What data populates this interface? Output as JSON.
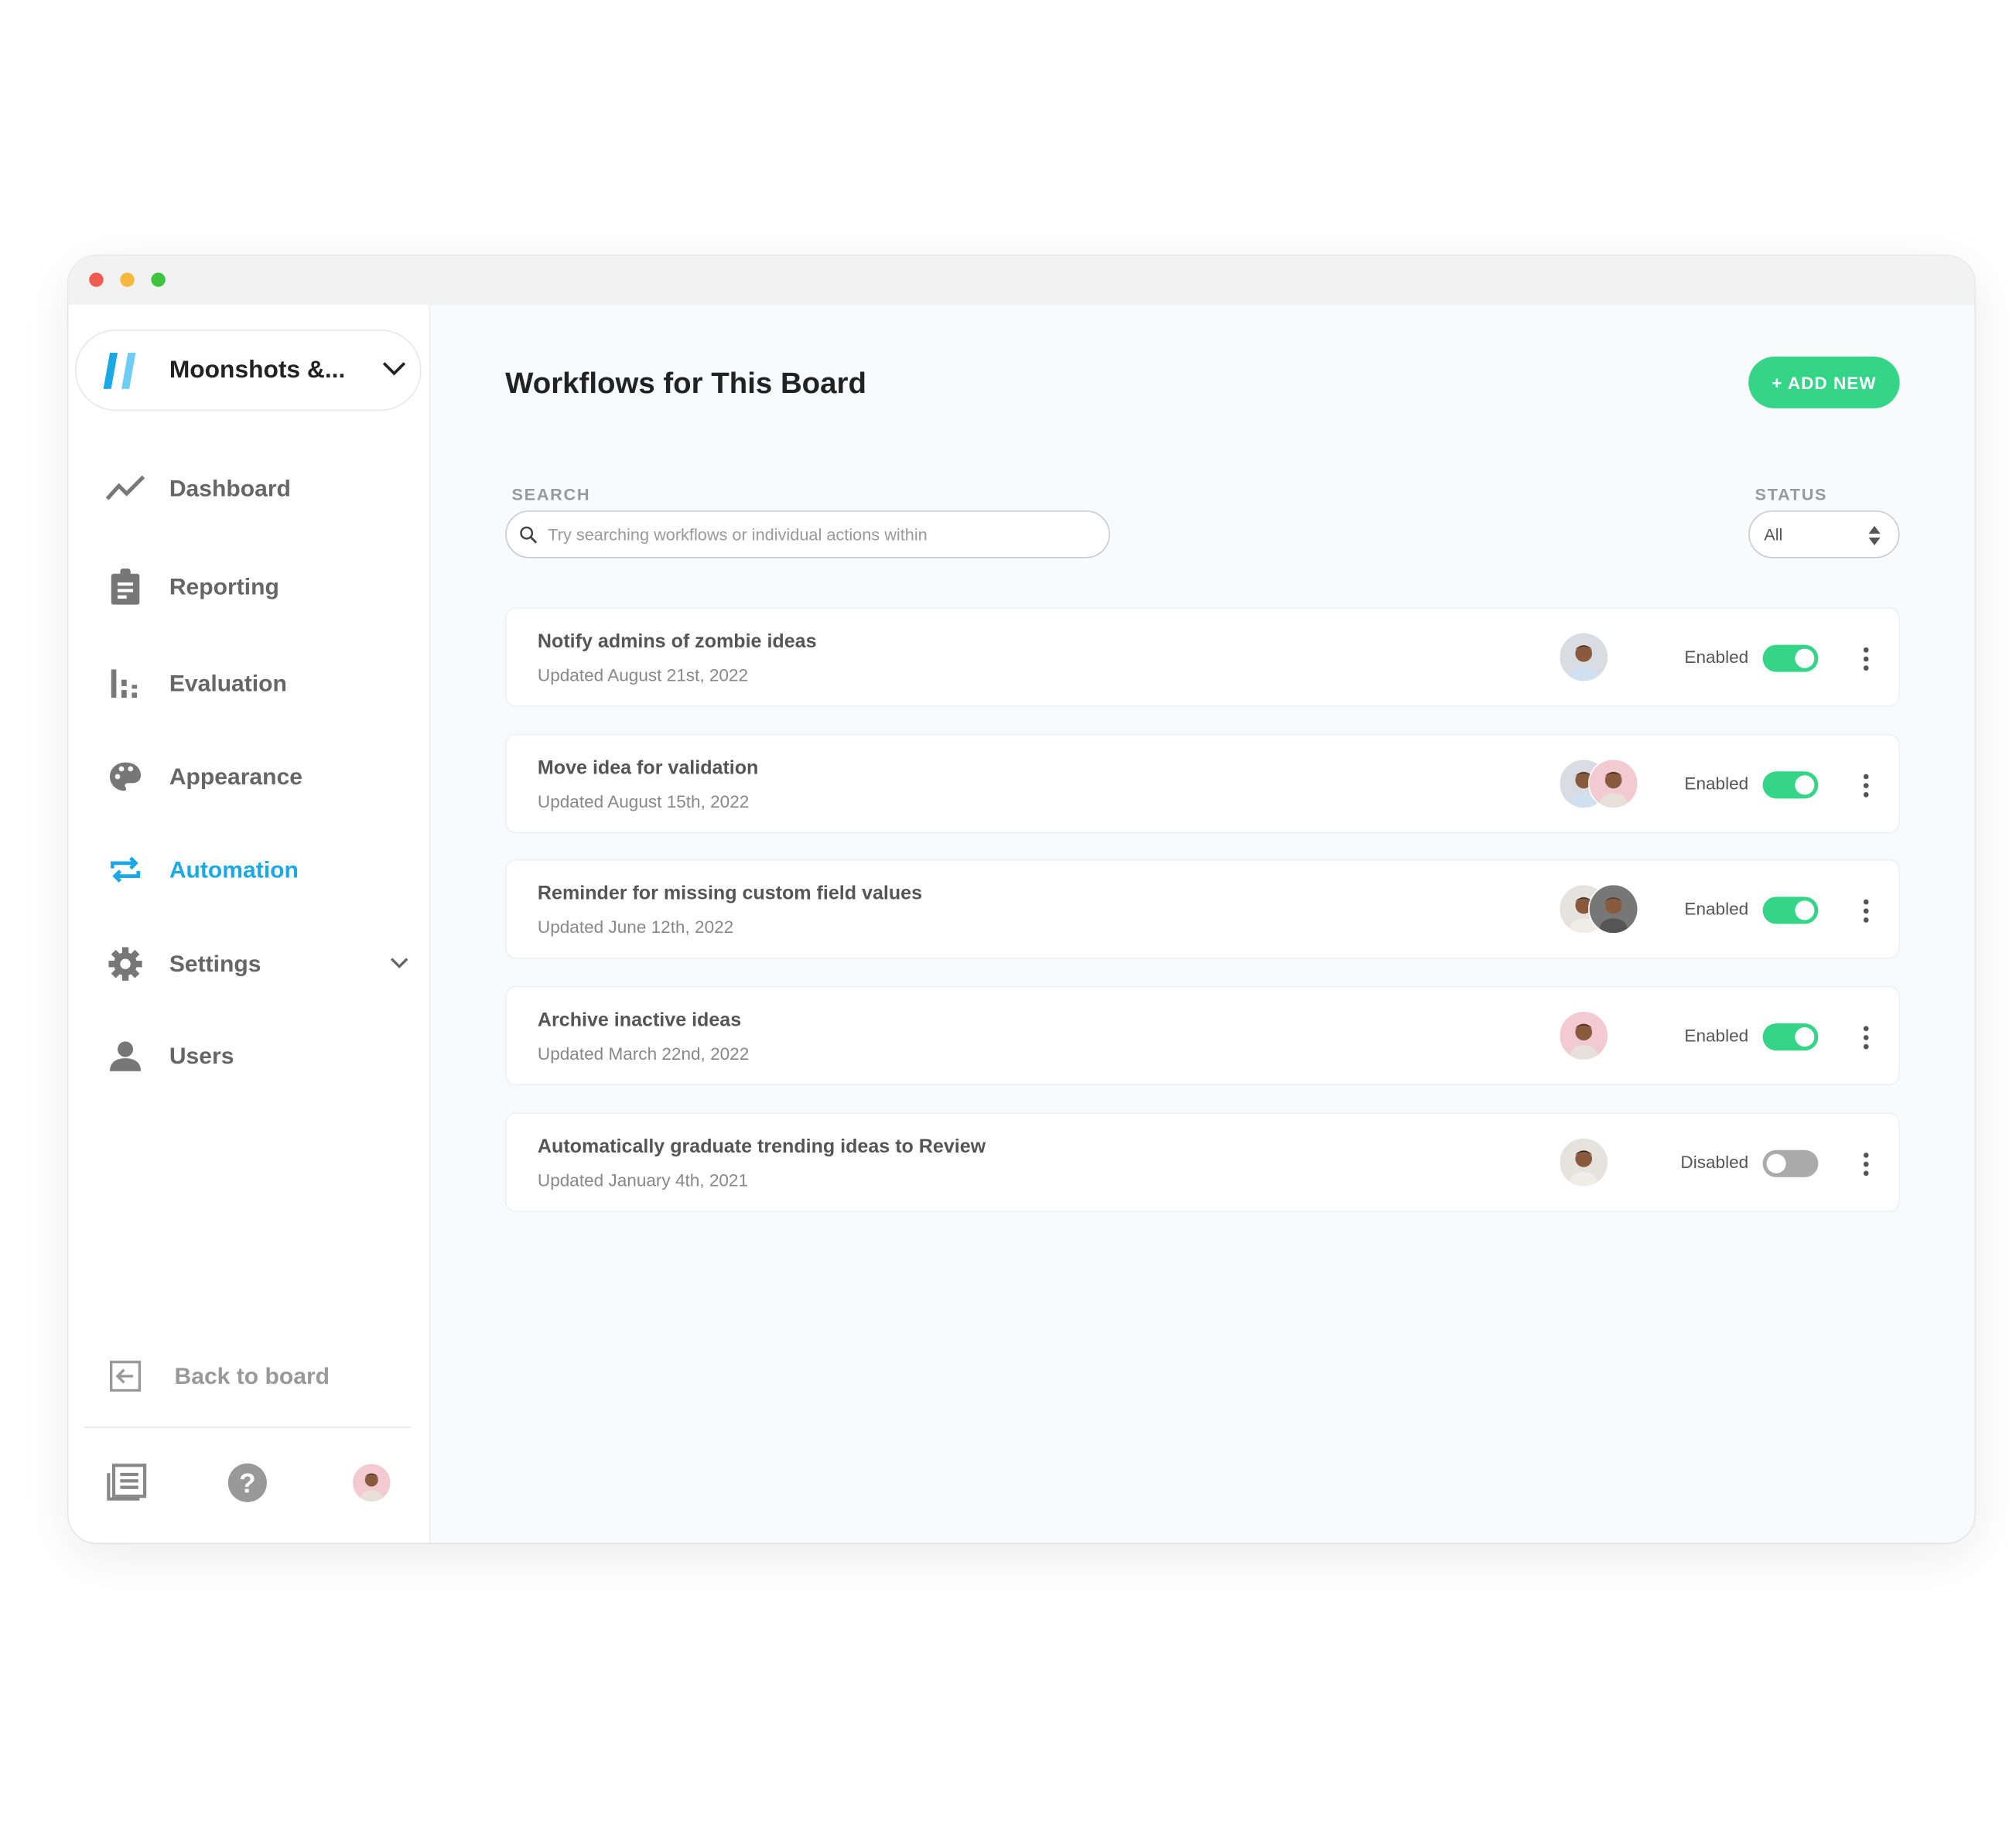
{
  "window": {
    "controls": [
      "close",
      "minimize",
      "maximize"
    ]
  },
  "sidebar": {
    "workspace": {
      "name": "Moonshots &...",
      "logo_colors": [
        "#1aa9e6",
        "#6fcdf5"
      ]
    },
    "items": [
      {
        "label": "Dashboard",
        "icon": "trend-line-icon"
      },
      {
        "label": "Reporting",
        "icon": "clipboard-icon"
      },
      {
        "label": "Evaluation",
        "icon": "bar-chart-icon"
      },
      {
        "label": "Appearance",
        "icon": "palette-icon"
      },
      {
        "label": "Automation",
        "icon": "repeat-icon",
        "active": true
      },
      {
        "label": "Settings",
        "icon": "gear-icon",
        "expandable": true
      },
      {
        "label": "Users",
        "icon": "user-icon"
      }
    ],
    "back_label": "Back to board",
    "footer_icons": [
      "news-icon",
      "help-icon",
      "avatar"
    ]
  },
  "main": {
    "title": "Workflows for This Board",
    "add_button": "+ ADD NEW",
    "search": {
      "label": "SEARCH",
      "placeholder": "Try searching workflows or individual actions within"
    },
    "status": {
      "label": "STATUS",
      "value": "All"
    },
    "workflows": [
      {
        "title": "Notify admins of zombie ideas",
        "updated": "Updated August 21st, 2022",
        "status": "Enabled",
        "enabled": true,
        "avatars": [
          "a"
        ]
      },
      {
        "title": "Move idea for validation",
        "updated": "Updated August 15th, 2022",
        "status": "Enabled",
        "enabled": true,
        "avatars": [
          "a",
          "b"
        ]
      },
      {
        "title": "Reminder for missing custom field values",
        "updated": "Updated June 12th, 2022",
        "status": "Enabled",
        "enabled": true,
        "avatars": [
          "c",
          "d"
        ]
      },
      {
        "title": "Archive inactive ideas",
        "updated": "Updated March 22nd, 2022",
        "status": "Enabled",
        "enabled": true,
        "avatars": [
          "b"
        ]
      },
      {
        "title": "Automatically graduate trending ideas to Review",
        "updated": "Updated January 4th, 2021",
        "status": "Disabled",
        "enabled": false,
        "avatars": [
          "c"
        ]
      }
    ]
  },
  "colors": {
    "accent": "#34d587",
    "active_nav": "#1aa9e6",
    "toggle_off": "#aaaaaa"
  }
}
